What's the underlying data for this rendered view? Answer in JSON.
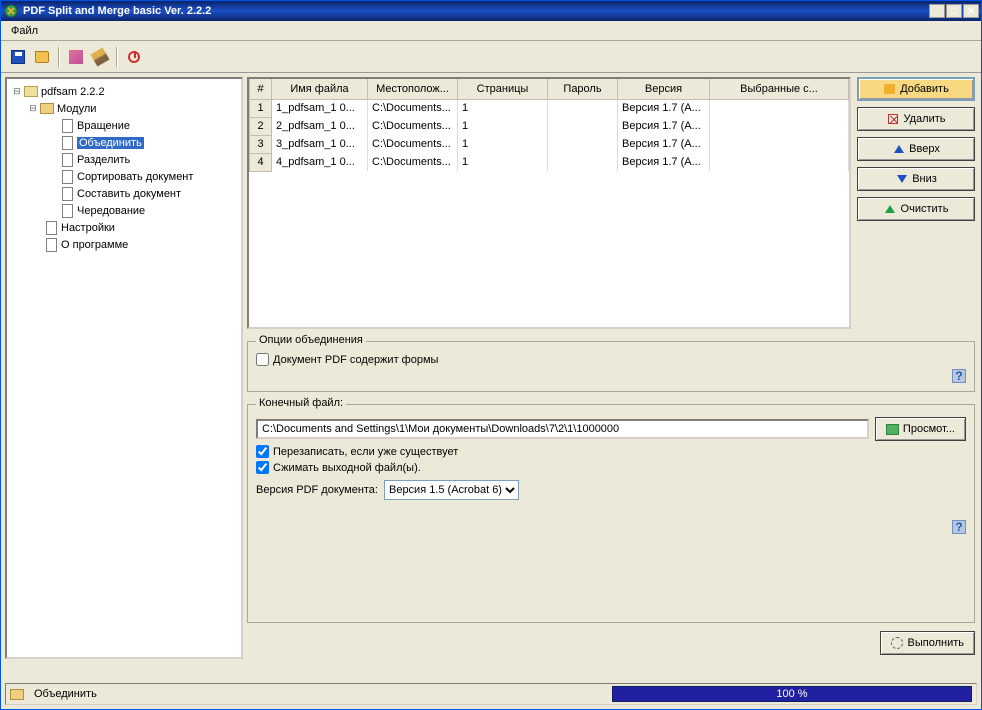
{
  "window": {
    "title": "PDF Split and Merge basic Ver. 2.2.2"
  },
  "menubar": {
    "file": "Файл"
  },
  "tree": {
    "root": "pdfsam 2.2.2",
    "modules": "Модули",
    "items": [
      "Вращение",
      "Объединить",
      "Разделить",
      "Сортировать документ",
      "Составить документ",
      "Чередование"
    ],
    "settings": "Настройки",
    "about": "О программе"
  },
  "table": {
    "headers": {
      "num": "#",
      "filename": "Имя файла",
      "location": "Местополож...",
      "pages": "Страницы",
      "password": "Пароль",
      "version": "Версия",
      "selected_pages": "Выбранные с..."
    },
    "rows": [
      {
        "n": "1",
        "f": "1_pdfsam_1 0...",
        "l": "C:\\Documents...",
        "p": "1",
        "pw": "",
        "v": "Версия 1.7 (A...",
        "sp": ""
      },
      {
        "n": "2",
        "f": "2_pdfsam_1 0...",
        "l": "C:\\Documents...",
        "p": "1",
        "pw": "",
        "v": "Версия 1.7 (A...",
        "sp": ""
      },
      {
        "n": "3",
        "f": "3_pdfsam_1 0...",
        "l": "C:\\Documents...",
        "p": "1",
        "pw": "",
        "v": "Версия 1.7 (A...",
        "sp": ""
      },
      {
        "n": "4",
        "f": "4_pdfsam_1 0...",
        "l": "C:\\Documents...",
        "p": "1",
        "pw": "",
        "v": "Версия 1.7 (A...",
        "sp": ""
      }
    ]
  },
  "buttons": {
    "add": "Добавить",
    "remove": "Удалить",
    "up": "Вверх",
    "down": "Вниз",
    "clear": "Очистить",
    "browse": "Просмот...",
    "run": "Выполнить"
  },
  "options": {
    "group_title": "Опции объединения",
    "checkbox_forms": "Документ PDF содержит формы"
  },
  "output": {
    "group_title": "Конечный файл:",
    "path": "C:\\Documents and Settings\\1\\Мои документы\\Downloads\\7\\2\\1\\1000000",
    "overwrite": "Перезаписать, если уже существует",
    "compress": "Сжимать выходной файл(ы).",
    "pdf_version_label": "Версия PDF документа:",
    "pdf_version_value": "Версия 1.5 (Acrobat 6)"
  },
  "status": {
    "text": "Объединить",
    "progress": "100 %"
  }
}
